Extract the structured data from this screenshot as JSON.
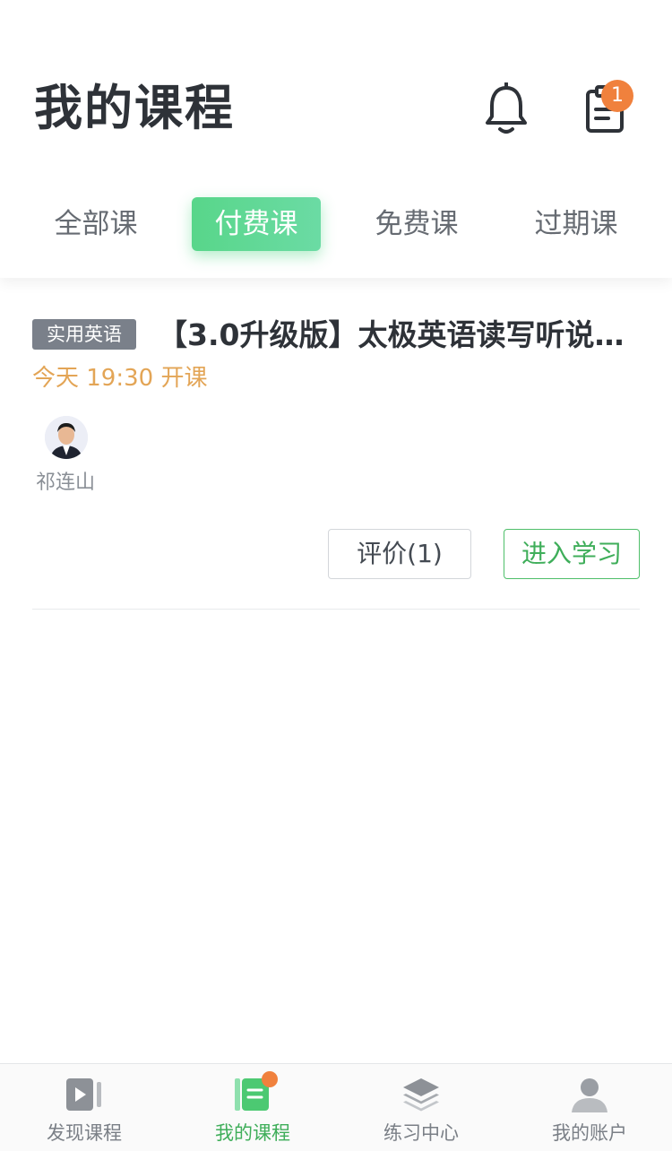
{
  "header": {
    "title": "我的课程",
    "notification_icon": "bell-icon",
    "clipboard_icon": "clipboard-icon",
    "clipboard_badge": "1"
  },
  "tabs": [
    {
      "label": "全部课",
      "active": false
    },
    {
      "label": "付费课",
      "active": true
    },
    {
      "label": "免费课",
      "active": false
    },
    {
      "label": "过期课",
      "active": false
    }
  ],
  "course": {
    "tag": "实用英语",
    "title": "【3.0升级版】太极英语读写听说…",
    "schedule": "今天 19:30 开课",
    "teacher_name": "祁连山",
    "review_button": "评价(1)",
    "enter_button": "进入学习"
  },
  "bottom_nav": [
    {
      "label": "发现课程",
      "icon": "video-play-icon",
      "active": false
    },
    {
      "label": "我的课程",
      "icon": "book-icon",
      "active": true
    },
    {
      "label": "练习中心",
      "icon": "layers-icon",
      "active": false
    },
    {
      "label": "我的账户",
      "icon": "user-icon",
      "active": false
    }
  ],
  "colors": {
    "accent_green": "#58d68a",
    "badge_orange": "#f0813d",
    "schedule_orange": "#e3a556",
    "tag_gray": "#7a808a"
  }
}
